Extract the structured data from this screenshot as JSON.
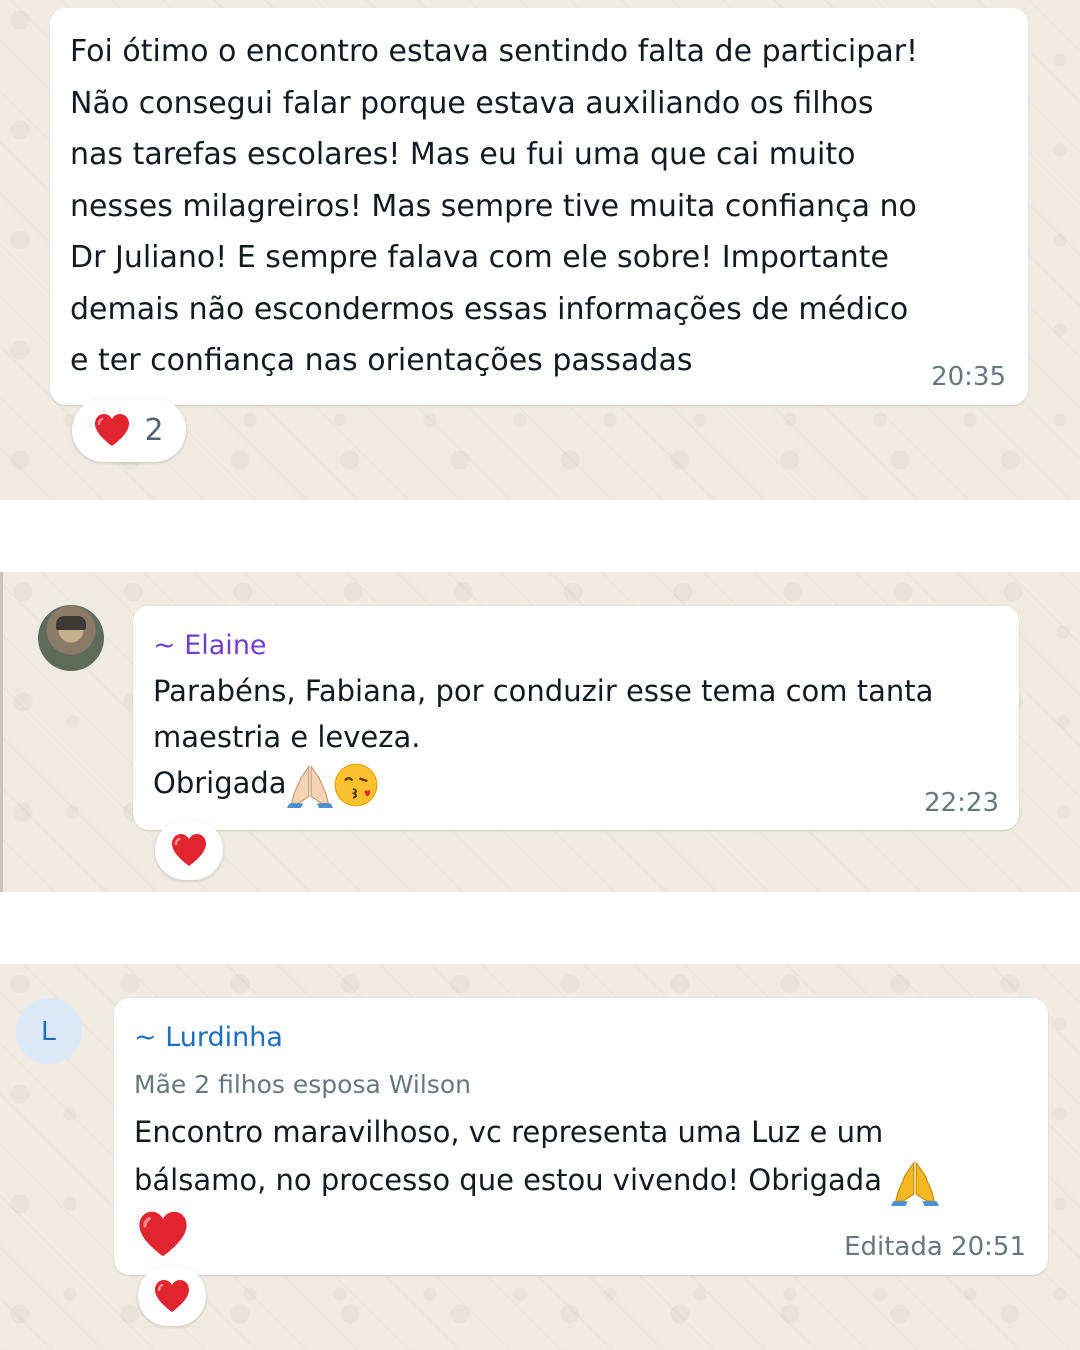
{
  "messages": [
    {
      "text": "Foi ótimo o encontro estava sentindo falta de participar!\nNão consegui falar porque estava auxiliando os filhos\nnas tarefas escolares! Mas eu fui uma que cai muito\nnesses milagreiros! Mas sempre tive muita confiança no\nDr Juliano! E sempre falava com ele sobre! Importante\ndemais não escondermos essas informações de médico\ne ter confiança nas orientações passadas",
      "time": "20:35",
      "reaction": {
        "emoji": "heart-icon",
        "count": "2"
      }
    },
    {
      "sender": "~ Elaine",
      "sender_color": "#6f3fd1",
      "text_lines": [
        "Parabéns, Fabiana, por conduzir esse tema com tanta",
        "maestria e leveza."
      ],
      "last_line": "Obrigada",
      "emojis": [
        "folded-hands-icon",
        "kissing-face-icon"
      ],
      "time": "22:23",
      "reaction": {
        "emoji": "heart-icon"
      }
    },
    {
      "sender": "~ Lurdinha",
      "sender_color": "#1f6fc0",
      "avatar_initial": "L",
      "subtitle": "Mãe 2 filhos esposa Wilson",
      "text_lines": [
        "Encontro maravilhoso, vc representa uma Luz  e um",
        "bálsamo, no processo que estou vivendo!  Obrigada"
      ],
      "emojis": [
        "folded-hands-icon",
        "heart-icon"
      ],
      "time": "Editada 20:51",
      "reaction": {
        "emoji": "heart-icon"
      }
    }
  ],
  "colors": {
    "chat_bg": "#efeae2",
    "bubble": "#ffffff",
    "meta_text": "#667781",
    "heart": "#e0252f"
  }
}
